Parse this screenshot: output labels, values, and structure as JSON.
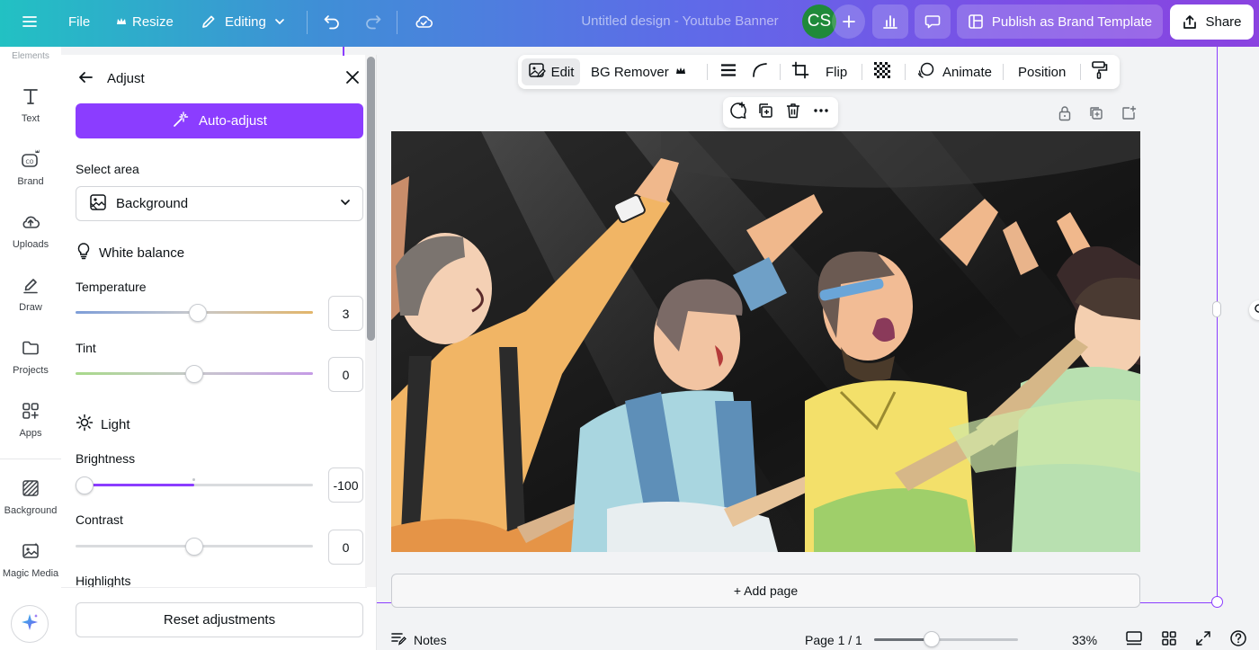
{
  "topbar": {
    "file_label": "File",
    "resize_label": "Resize",
    "editing_label": "Editing",
    "doc_title": "Untitled design - Youtube Banner",
    "avatar_initials": "CS",
    "publish_label": "Publish as Brand Template",
    "share_label": "Share"
  },
  "rail": {
    "cut_label": "Elements",
    "items": [
      {
        "label": "Text",
        "icon": "text-icon"
      },
      {
        "label": "Brand",
        "icon": "brand-icon"
      },
      {
        "label": "Uploads",
        "icon": "uploads-icon"
      },
      {
        "label": "Draw",
        "icon": "draw-icon"
      },
      {
        "label": "Projects",
        "icon": "projects-icon"
      },
      {
        "label": "Apps",
        "icon": "apps-icon"
      },
      {
        "label": "Background",
        "icon": "background-icon"
      },
      {
        "label": "Magic Media",
        "icon": "magic-media-icon"
      }
    ]
  },
  "panel": {
    "title": "Adjust",
    "auto_adjust_label": "Auto-adjust",
    "select_area_label": "Select area",
    "select_area_value": "Background",
    "white_balance_title": "White balance",
    "light_title": "Light",
    "sliders": {
      "temperature": {
        "label": "Temperature",
        "value": "3",
        "level": 0.515
      },
      "tint": {
        "label": "Tint",
        "value": "0",
        "level": 0.5
      },
      "brightness": {
        "label": "Brightness",
        "value": "-100",
        "level": 0.0
      },
      "contrast": {
        "label": "Contrast",
        "value": "0",
        "level": 0.5
      }
    },
    "highlights_label": "Highlights",
    "reset_label": "Reset adjustments"
  },
  "context_toolbar": {
    "edit_label": "Edit",
    "bg_remover_label": "BG Remover",
    "flip_label": "Flip",
    "animate_label": "Animate",
    "position_label": "Position"
  },
  "canvas": {
    "add_page_label": "+ Add page"
  },
  "bottombar": {
    "notes_label": "Notes",
    "page_indicator": "Page 1 / 1",
    "zoom_level": "33%",
    "zoom_fraction": 0.4
  },
  "colors": {
    "accent": "#8b3dff",
    "avatar_bg": "#1f8a3a"
  }
}
